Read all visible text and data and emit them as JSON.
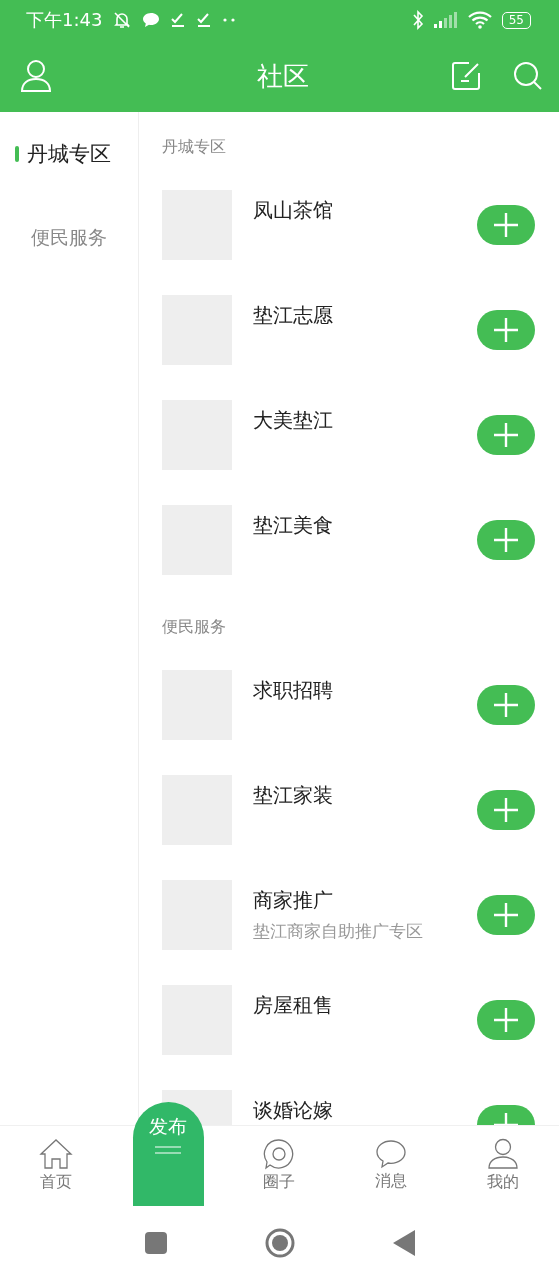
{
  "status_bar": {
    "time": "下午1:43",
    "battery": "55"
  },
  "header": {
    "title": "社区"
  },
  "sidebar": {
    "items": [
      {
        "label": "丹城专区",
        "selected": true
      },
      {
        "label": "便民服务",
        "selected": false
      }
    ]
  },
  "sections": [
    {
      "title": "丹城专区",
      "items": [
        {
          "name": "凤山茶馆"
        },
        {
          "name": "垫江志愿"
        },
        {
          "name": "大美垫江"
        },
        {
          "name": "垫江美食"
        }
      ]
    },
    {
      "title": "便民服务",
      "items": [
        {
          "name": "求职招聘"
        },
        {
          "name": "垫江家装"
        },
        {
          "name": "商家推广",
          "subtitle": "垫江商家自助推广专区"
        },
        {
          "name": "房屋租售"
        },
        {
          "name": "谈婚论嫁"
        }
      ]
    }
  ],
  "bottom_nav": [
    {
      "label": "首页",
      "kind": "home"
    },
    {
      "label": "发布",
      "kind": "publish"
    },
    {
      "label": "圈子",
      "kind": "circle"
    },
    {
      "label": "消息",
      "kind": "message"
    },
    {
      "label": "我的",
      "kind": "profile"
    }
  ]
}
